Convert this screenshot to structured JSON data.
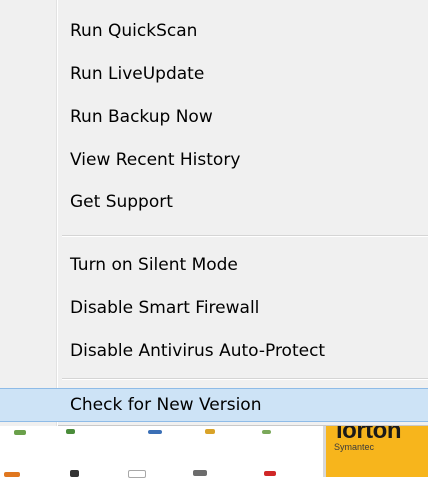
{
  "context_menu": {
    "group1": [
      {
        "label": "Run QuickScan"
      },
      {
        "label": "Run LiveUpdate"
      },
      {
        "label": "Run Backup Now"
      },
      {
        "label": "View Recent History"
      },
      {
        "label": "Get Support"
      }
    ],
    "group2": [
      {
        "label": "Turn on Silent Mode"
      },
      {
        "label": "Disable Smart Firewall"
      },
      {
        "label": "Disable Antivirus Auto-Protect"
      }
    ],
    "group3": [
      {
        "label": "Check for New Version",
        "highlighted": true
      }
    ]
  },
  "background_app": {
    "logo_text": "lorton",
    "logo_subtext": "Symantec"
  },
  "colors": {
    "menu_background": "#f0f0f0",
    "highlight_fill": "#cde3f6",
    "highlight_border": "#8ebbe7",
    "norton_brand": "#f7b51c"
  }
}
